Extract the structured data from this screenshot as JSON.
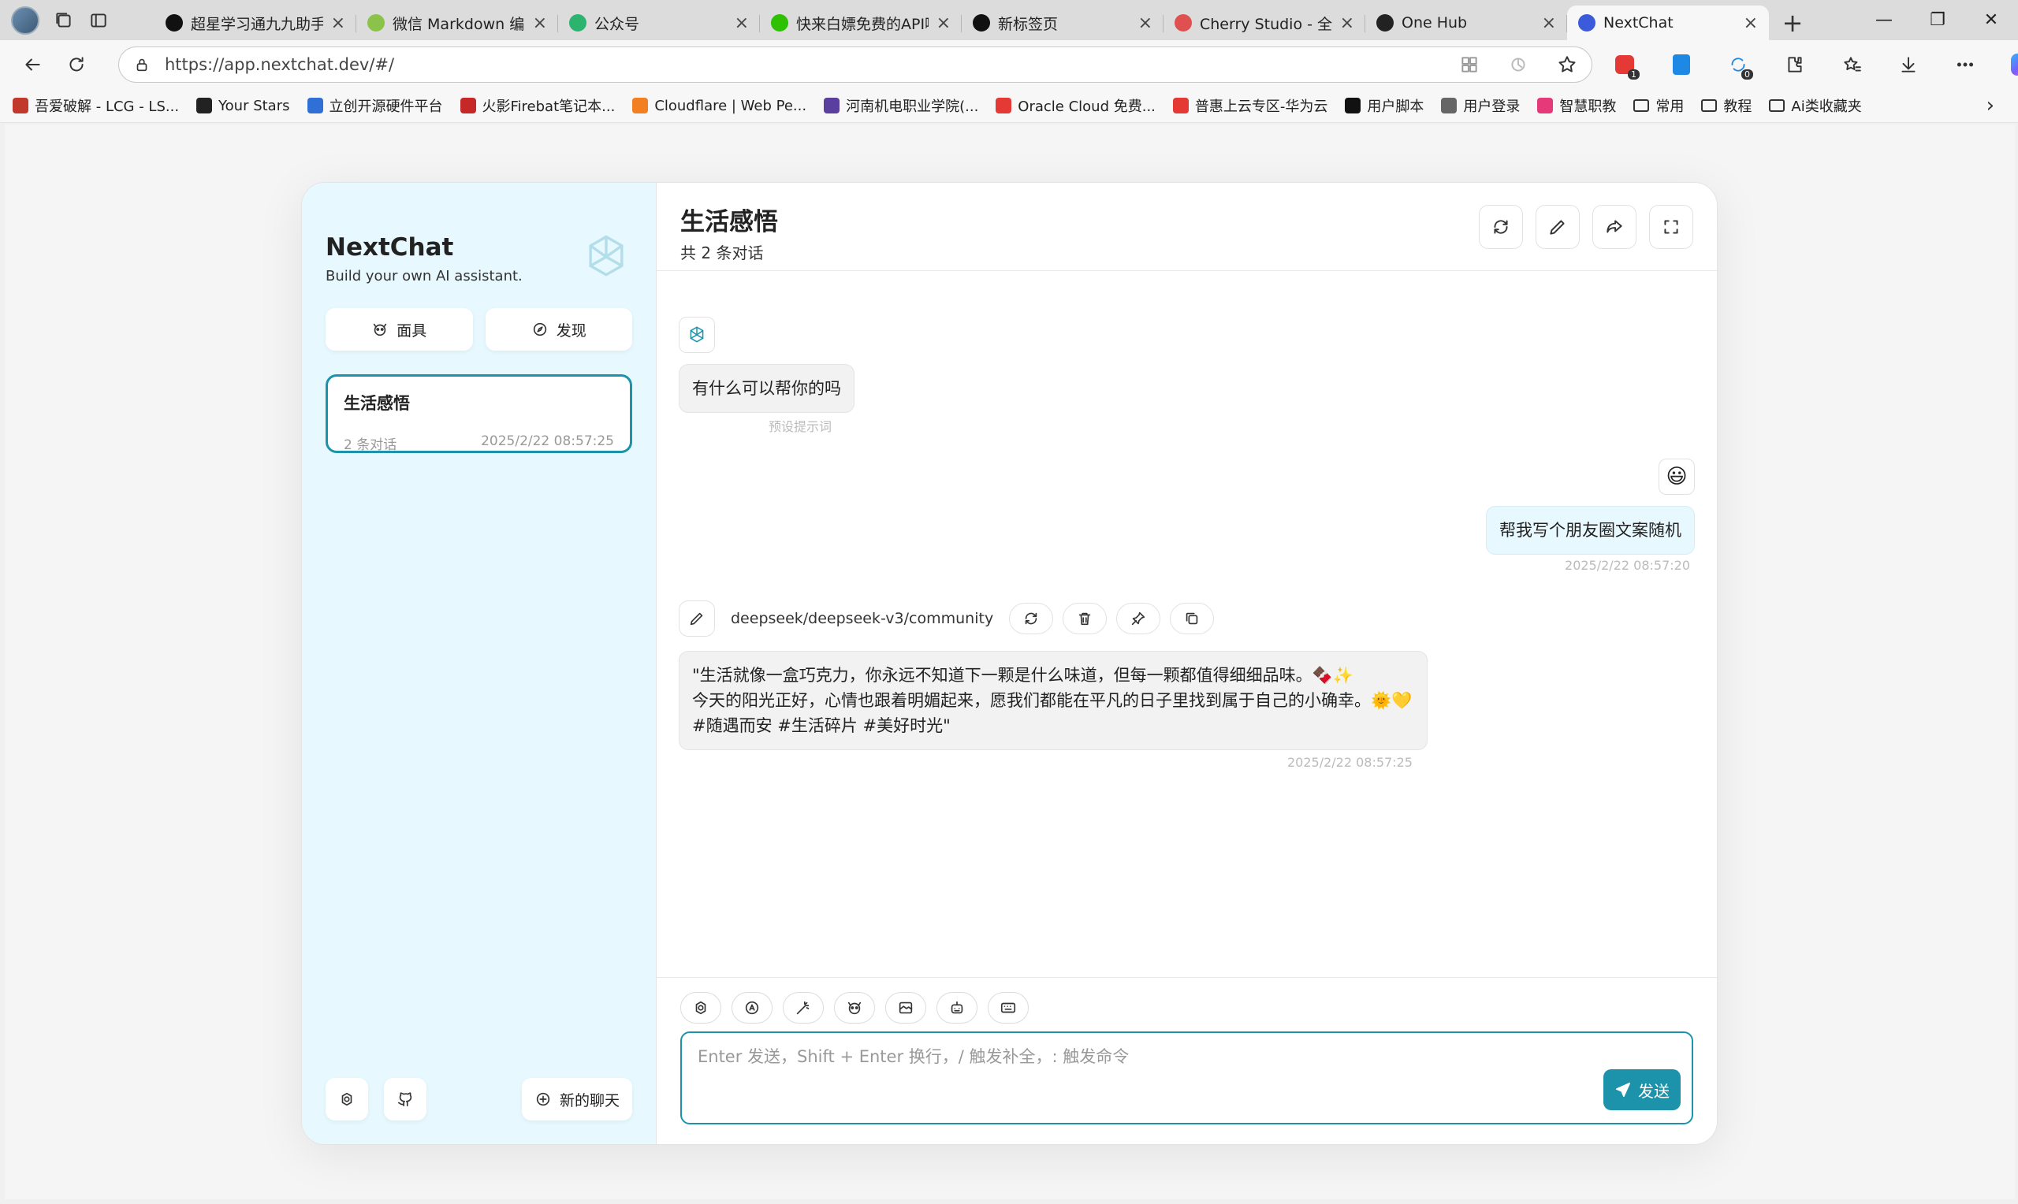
{
  "browser": {
    "tabs": [
      {
        "title": "超星学习通九九助手",
        "color": "#111"
      },
      {
        "title": "微信 Markdown 编辑",
        "color": "#8bc34a"
      },
      {
        "title": "公众号",
        "color": "#2cb46e"
      },
      {
        "title": "快来白嫖免费的API啊",
        "color": "#2dc100"
      },
      {
        "title": "新标签页",
        "color": "#111"
      },
      {
        "title": "Cherry Studio - 全能",
        "color": "#e05050"
      },
      {
        "title": "One Hub",
        "color": "#222"
      },
      {
        "title": "NextChat",
        "color": "#3b5bdb"
      }
    ],
    "url": "https://app.nextchat.dev/#/",
    "extension_badges": [
      "1",
      "0"
    ],
    "bookmarks": [
      {
        "label": "吾爱破解 - LCG - LS...",
        "color": "#c0392b"
      },
      {
        "label": "Your Stars",
        "color": "#222"
      },
      {
        "label": "立创开源硬件平台",
        "color": "#2f6fd6"
      },
      {
        "label": "火影Firebat笔记本...",
        "color": "#c62828"
      },
      {
        "label": "Cloudflare | Web Pe...",
        "color": "#f38020"
      },
      {
        "label": "河南机电职业学院(...",
        "color": "#5b3f9e"
      },
      {
        "label": "Oracle Cloud 免费...",
        "color": "#e53935"
      },
      {
        "label": "普惠上云专区-华为云",
        "color": "#e53935"
      },
      {
        "label": "用户脚本",
        "color": "#111"
      },
      {
        "label": "用户登录",
        "color": "#666"
      },
      {
        "label": "智慧职教",
        "color": "#e5397a"
      },
      {
        "label": "常用",
        "color": "folder"
      },
      {
        "label": "教程",
        "color": "folder"
      },
      {
        "label": "Ai类收藏夹",
        "color": "folder"
      }
    ]
  },
  "sidebar": {
    "title": "NextChat",
    "subtitle": "Build your own AI assistant.",
    "mask_label": "面具",
    "discover_label": "发现",
    "chat": {
      "title": "生活感悟",
      "count": "2 条对话",
      "time": "2025/2/22 08:57:25"
    },
    "new_chat_label": "新的聊天"
  },
  "main": {
    "title": "生活感悟",
    "subtitle": "共 2 条对话",
    "messages": {
      "greeting": "有什么可以帮你的吗",
      "greeting_note": "预设提示词",
      "user_emoji": "😃",
      "user_text": "帮我写个朋友圈文案随机",
      "user_time": "2025/2/22 08:57:20",
      "model": "deepseek/deepseek-v3/community",
      "reply_lines": [
        "\"生活就像一盒巧克力，你永远不知道下一颗是什么味道，但每一颗都值得细细品味。🍫✨",
        "今天的阳光正好，心情也跟着明媚起来，愿我们都能在平凡的日子里找到属于自己的小确幸。🌞💛",
        "#随遇而安 #生活碎片 #美好时光\""
      ],
      "reply_time": "2025/2/22 08:57:25"
    },
    "input_placeholder": "Enter 发送，Shift + Enter 换行，/ 触发补全，: 触发命令",
    "send_label": "发送"
  }
}
